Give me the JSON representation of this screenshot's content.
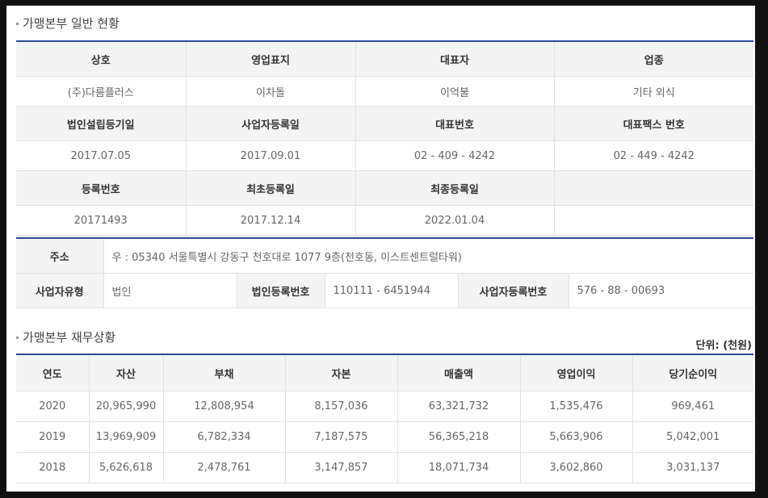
{
  "general": {
    "title": "가맹본부 일반 현황",
    "row1_headers": [
      "상호",
      "영업표지",
      "대표자",
      "업종"
    ],
    "row1_values": [
      "(주)다름플러스",
      "이차돌",
      "이억불",
      "기타 외식"
    ],
    "row2_headers": [
      "법인설립등기일",
      "사업자등록일",
      "대표번호",
      "대표팩스 번호"
    ],
    "row2_values": [
      "2017.07.05",
      "2017.09.01",
      "02 - 409 - 4242",
      "02 - 449 - 4242"
    ],
    "row3_headers": [
      "등록번호",
      "최초등록일",
      "최종등록일",
      ""
    ],
    "row3_values": [
      "20171493",
      "2017.12.14",
      "2022.01.04",
      ""
    ]
  },
  "address": {
    "label": "주소",
    "value": "우 : 05340 서울특별시 강동구 천호대로 1077 9층(천호동, 이스트센트럴타워)",
    "type_label": "사업자유형",
    "type_value": "법인",
    "corp_no_label": "법인등록번호",
    "corp_no_value": "110111 - 6451944",
    "biz_no_label": "사업자등록번호",
    "biz_no_value": "576 - 88 - 00693"
  },
  "finance": {
    "title": "가맹본부 재무상황",
    "unit": "단위: (천원)",
    "headers": [
      "연도",
      "자산",
      "부채",
      "자본",
      "매출액",
      "영업이익",
      "당기순이익"
    ],
    "rows": [
      [
        "2020",
        "20,965,990",
        "12,808,954",
        "8,157,036",
        "63,321,732",
        "1,535,476",
        "969,461"
      ],
      [
        "2019",
        "13,969,909",
        "6,782,334",
        "7,187,575",
        "56,365,218",
        "5,663,906",
        "5,042,001"
      ],
      [
        "2018",
        "5,626,618",
        "2,478,761",
        "3,147,857",
        "18,071,734",
        "3,602,860",
        "3,031,137"
      ]
    ]
  }
}
